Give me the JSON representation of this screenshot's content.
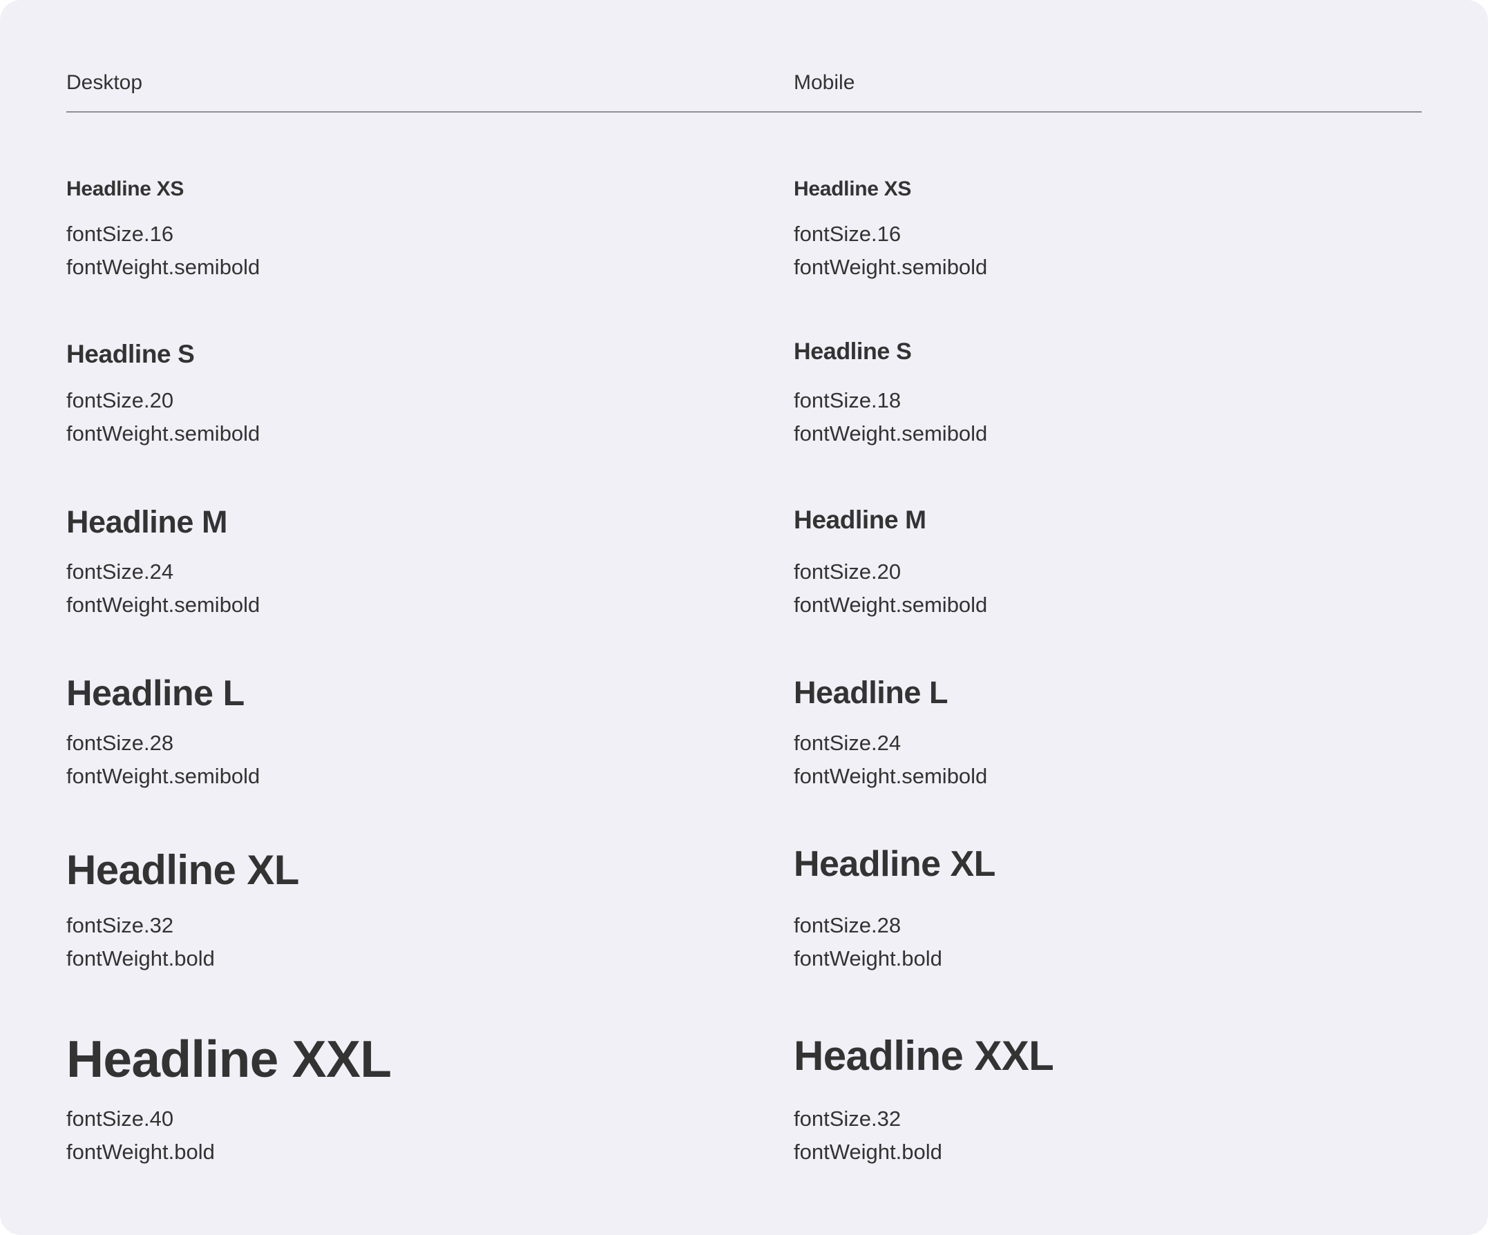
{
  "columns": {
    "desktop": {
      "label": "Desktop",
      "styles": [
        {
          "name": "Headline XS",
          "size": "fontSize.16",
          "weight": "fontWeight.semibold"
        },
        {
          "name": "Headline S",
          "size": "fontSize.20",
          "weight": "fontWeight.semibold"
        },
        {
          "name": "Headline M",
          "size": "fontSize.24",
          "weight": "fontWeight.semibold"
        },
        {
          "name": "Headline L",
          "size": "fontSize.28",
          "weight": "fontWeight.semibold"
        },
        {
          "name": "Headline XL",
          "size": "fontSize.32",
          "weight": "fontWeight.bold"
        },
        {
          "name": "Headline XXL",
          "size": "fontSize.40",
          "weight": "fontWeight.bold"
        }
      ]
    },
    "mobile": {
      "label": "Mobile",
      "styles": [
        {
          "name": "Headline XS",
          "size": "fontSize.16",
          "weight": "fontWeight.semibold"
        },
        {
          "name": "Headline S",
          "size": "fontSize.18",
          "weight": "fontWeight.semibold"
        },
        {
          "name": "Headline M",
          "size": "fontSize.20",
          "weight": "fontWeight.semibold"
        },
        {
          "name": "Headline L",
          "size": "fontSize.24",
          "weight": "fontWeight.semibold"
        },
        {
          "name": "Headline XL",
          "size": "fontSize.28",
          "weight": "fontWeight.bold"
        },
        {
          "name": "Headline XXL",
          "size": "fontSize.32",
          "weight": "fontWeight.bold"
        }
      ]
    }
  }
}
